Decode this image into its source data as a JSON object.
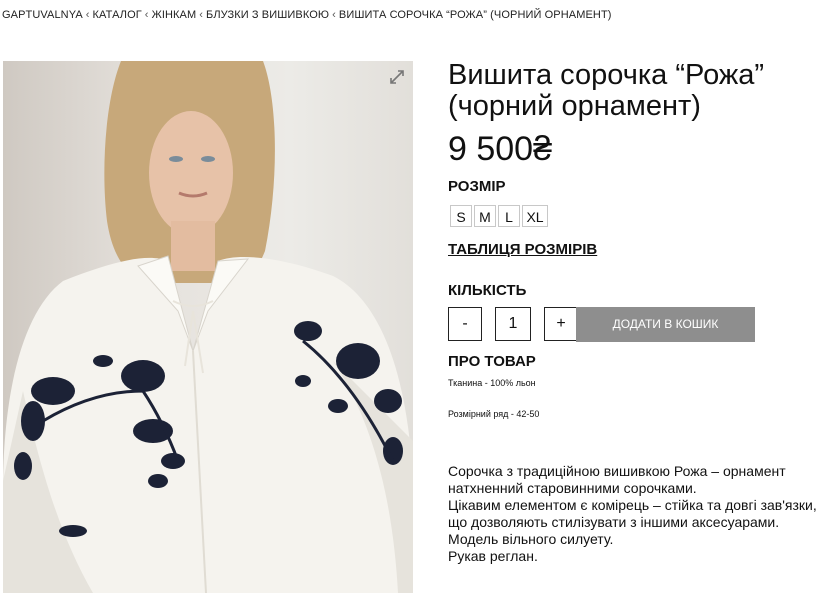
{
  "breadcrumb": [
    "GAPTUVALNYA",
    "КАТАЛОГ",
    "ЖІНКАМ",
    "БЛУЗКИ З ВИШИВКОЮ",
    "ВИШИТА СОРОЧКА “РОЖА” (ЧОРНИЙ ОРНАМЕНТ)"
  ],
  "product": {
    "title": "Вишита сорочка “Рожа” (чорний орнамент)",
    "price": "9 500",
    "currency": "₴"
  },
  "size": {
    "label": "РОЗМІР",
    "options": [
      "S",
      "M",
      "L",
      "XL"
    ],
    "table_link": "ТАБЛИЦЯ РОЗМІРІВ"
  },
  "quantity": {
    "label": "КІЛЬКІСТЬ",
    "minus": "-",
    "value": "1",
    "plus": "+"
  },
  "cart": {
    "add_label": "ДОДАТИ В КОШИК"
  },
  "about": {
    "label": "ПРО ТОВАР",
    "fabric": "Тканина - 100% льон",
    "size_range": "Розмірний ряд - 42-50"
  },
  "description": [
    "Сорочка з традиційною вишивкою Рожа – орнамент натхненний старовинними сорочками.",
    "Цікавим елементом є комірець – стійка та довгі зав'язки, що дозволяють стилізувати з іншими аксесуарами.",
    "Модель вільного силуету.",
    "Рукав реглан."
  ],
  "colors": {
    "button_bg": "#8e8e8e",
    "embroidery": "#1c2236"
  },
  "icons": {
    "expand": "expand-icon"
  }
}
